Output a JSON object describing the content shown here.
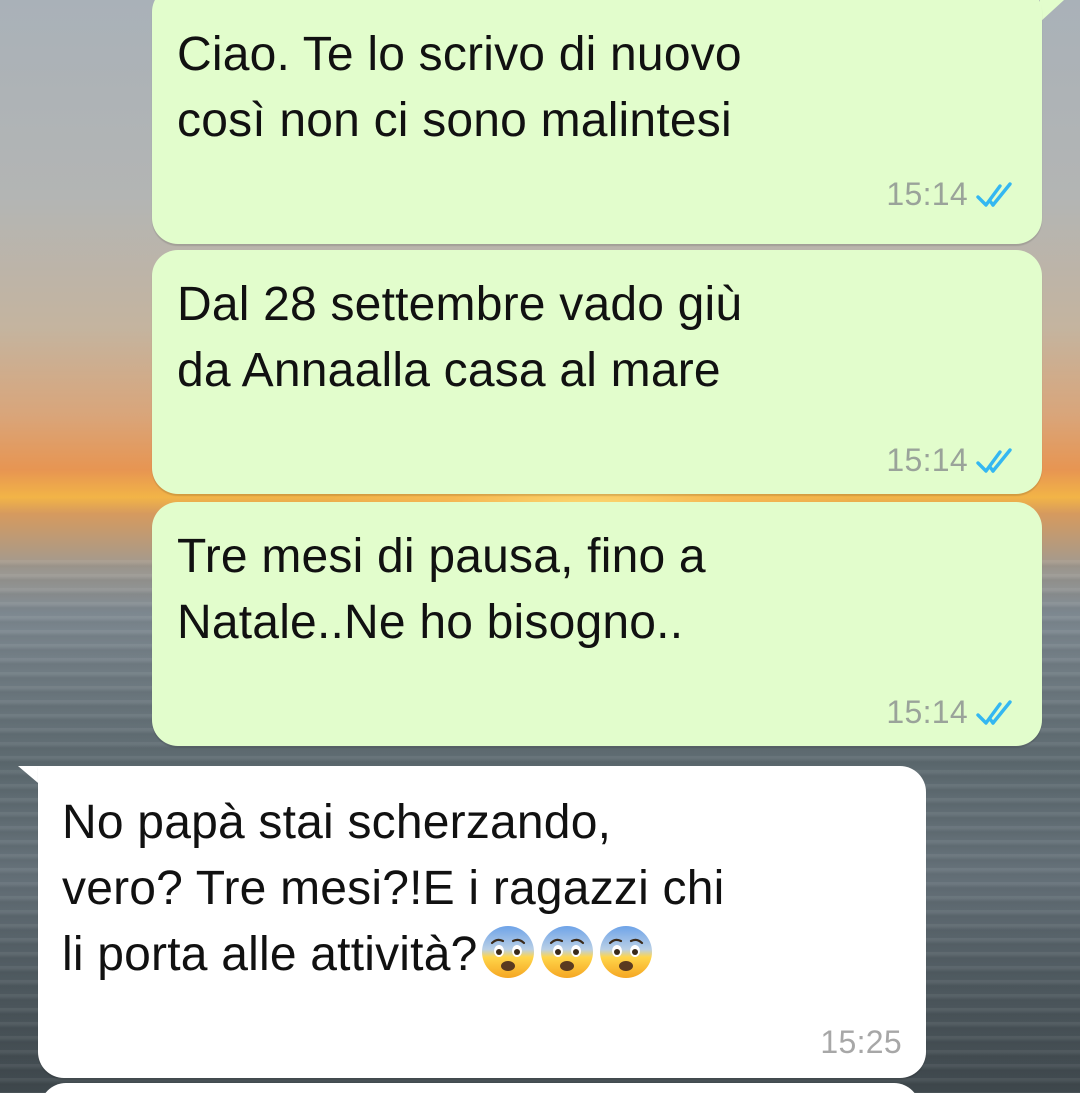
{
  "chat": {
    "messages": [
      {
        "direction": "outgoing",
        "text": "Ciao. Te lo scrivo di nuovo\ncosì non ci sono malintesi",
        "time": "15:14",
        "status": "read",
        "status_icon": "double-check-icon"
      },
      {
        "direction": "outgoing",
        "text": "Dal 28 settembre vado giù\nda Annaalla casa al mare",
        "time": "15:14",
        "status": "read",
        "status_icon": "double-check-icon"
      },
      {
        "direction": "outgoing",
        "text": "Tre mesi di pausa, fino a\nNatale..Ne ho bisogno..",
        "time": "15:14",
        "status": "read",
        "status_icon": "double-check-icon"
      },
      {
        "direction": "incoming",
        "text": "No papà stai scherzando,\nvero? Tre mesi?!E i ragazzi chi\nli porta alle attività?",
        "emojis": [
          "fearful-face",
          "fearful-face",
          "fearful-face"
        ],
        "time": "15:25"
      }
    ]
  },
  "colors": {
    "outgoing_bubble": "#e2fdcc",
    "incoming_bubble": "#ffffff",
    "read_ticks": "#34b7f1",
    "timestamp": "#9aa39a"
  }
}
